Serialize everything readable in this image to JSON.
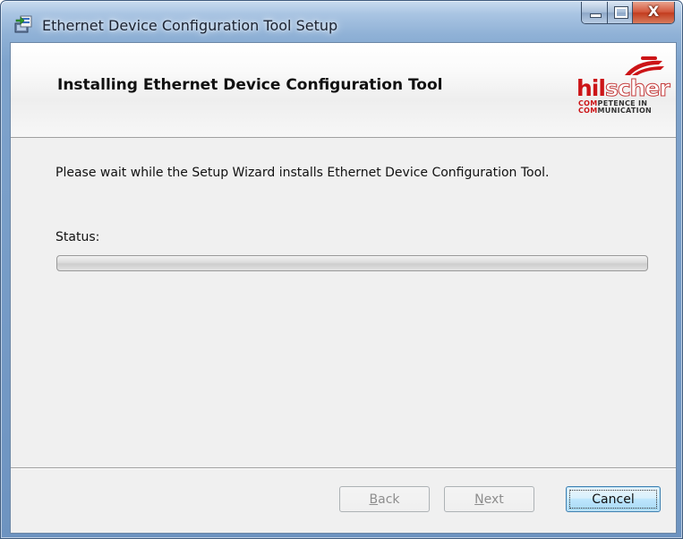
{
  "window": {
    "title": "Ethernet Device Configuration Tool Setup",
    "icon": "installer-icon",
    "caption_buttons": {
      "close_glyph": "X"
    }
  },
  "header": {
    "title": "Installing Ethernet Device Configuration Tool",
    "logo": {
      "word_red": "hil",
      "word_outline": "scher",
      "tag_line1_red": "COM",
      "tag_line1_rest": "PETENCE IN",
      "tag_line2_red": "COM",
      "tag_line2_rest": "MUNICATION"
    }
  },
  "main": {
    "description": "Please wait while the Setup Wizard installs Ethernet Device Configuration Tool.",
    "status_label": "Status:",
    "progress_percent": 0
  },
  "footer": {
    "back": {
      "mnemonic": "B",
      "rest": "ack",
      "enabled": false
    },
    "next": {
      "mnemonic": "N",
      "rest": "ext",
      "enabled": false
    },
    "cancel": {
      "label": "Cancel",
      "enabled": true
    }
  },
  "colors": {
    "accent_red": "#cc1417",
    "focus_button_border": "#3c7fb1"
  }
}
